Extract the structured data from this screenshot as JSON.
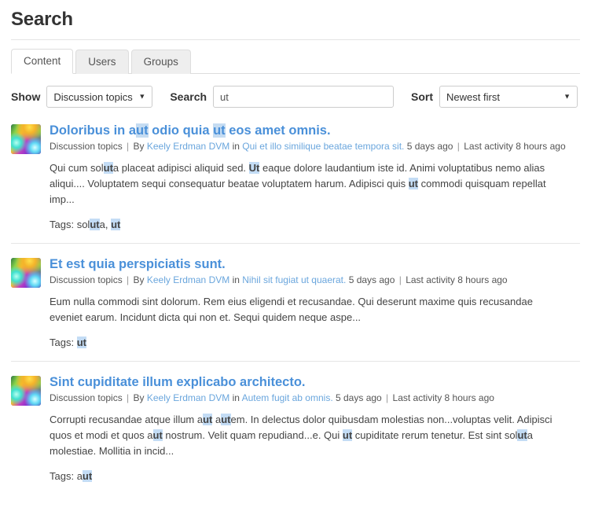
{
  "page": {
    "title": "Search"
  },
  "tabs": [
    {
      "label": "Content",
      "active": true
    },
    {
      "label": "Users",
      "active": false
    },
    {
      "label": "Groups",
      "active": false
    }
  ],
  "filters": {
    "show_label": "Show",
    "show_value": "Discussion topics",
    "show_options": [
      "Discussion topics"
    ],
    "search_label": "Search",
    "search_value": "ut",
    "search_placeholder": "",
    "sort_label": "Sort",
    "sort_value": "Newest first",
    "sort_options": [
      "Newest first"
    ],
    "caret_icon": "chevron-down-icon"
  },
  "colors": {
    "link": "#4a90d9",
    "meta_link": "#6aa6dd",
    "highlight_bg": "#c3dcf5",
    "divider": "#e5e5e5",
    "tab_inactive_bg": "#eeeeee"
  },
  "results": [
    {
      "title_parts": [
        {
          "t": "Doloribus in a",
          "hl": false
        },
        {
          "t": "ut",
          "hl": true
        },
        {
          "t": " odio quia ",
          "hl": false
        },
        {
          "t": "ut",
          "hl": true
        },
        {
          "t": " eos amet omnis.",
          "hl": false
        }
      ],
      "title_plain": "Doloribus in aut odio quia ut eos amet omnis.",
      "meta": {
        "type": "Discussion topics",
        "by_label": "By",
        "author": "Keely Erdman DVM",
        "in_label": "in",
        "container": "Qui et illo similique beatae tempora sit.",
        "posted": "5 days ago",
        "activity": "Last activity 8 hours ago"
      },
      "snippet_parts": [
        {
          "t": "Qui cum sol",
          "hl": false
        },
        {
          "t": "ut",
          "hl": true
        },
        {
          "t": "a placeat adipisci aliquid sed. ",
          "hl": false
        },
        {
          "t": "Ut",
          "hl": true
        },
        {
          "t": " eaque dolore laudantium iste id. Animi voluptatibus nemo alias aliqui.... Voluptatem sequi consequatur beatae voluptatem harum. Adipisci quis ",
          "hl": false
        },
        {
          "t": "ut",
          "hl": true
        },
        {
          "t": " commodi quisquam repellat imp...",
          "hl": false
        }
      ],
      "snippet_plain": "Qui cum soluta placeat adipisci aliquid sed. Ut eaque dolore laudantium iste id. Animi voluptatibus nemo alias aliqui.... Voluptatem sequi consequatur beatae voluptatem harum. Adipisci quis ut commodi quisquam repellat imp...",
      "tags_label": "Tags:",
      "tags_parts": [
        {
          "t": " sol",
          "hl": false
        },
        {
          "t": "ut",
          "hl": true
        },
        {
          "t": "a, ",
          "hl": false
        },
        {
          "t": "ut",
          "hl": true
        }
      ],
      "tags_plain": "soluta, ut",
      "avatar_icon": "avatar-thumbnail"
    },
    {
      "title_parts": [
        {
          "t": "Et est quia perspiciatis sunt.",
          "hl": false
        }
      ],
      "title_plain": "Et est quia perspiciatis sunt.",
      "meta": {
        "type": "Discussion topics",
        "by_label": "By",
        "author": "Keely Erdman DVM",
        "in_label": "in",
        "container": "Nihil sit fugiat ut quaerat.",
        "posted": "5 days ago",
        "activity": "Last activity 8 hours ago"
      },
      "snippet_parts": [
        {
          "t": "Eum nulla commodi sint dolorum. Rem eius eligendi et recusandae. Qui deserunt maxime quis recusandae eveniet earum. Incidunt dicta qui non et. Sequi quidem neque aspe...",
          "hl": false
        }
      ],
      "snippet_plain": "Eum nulla commodi sint dolorum. Rem eius eligendi et recusandae. Qui deserunt maxime quis recusandae eveniet earum. Incidunt dicta qui non et. Sequi quidem neque aspe...",
      "tags_label": "Tags:",
      "tags_parts": [
        {
          "t": " ",
          "hl": false
        },
        {
          "t": "ut",
          "hl": true
        }
      ],
      "tags_plain": "ut",
      "avatar_icon": "avatar-thumbnail"
    },
    {
      "title_parts": [
        {
          "t": "Sint cupiditate illum explicabo architecto.",
          "hl": false
        }
      ],
      "title_plain": "Sint cupiditate illum explicabo architecto.",
      "meta": {
        "type": "Discussion topics",
        "by_label": "By",
        "author": "Keely Erdman DVM",
        "in_label": "in",
        "container": "Autem fugit ab omnis.",
        "posted": "5 days ago",
        "activity": "Last activity 8 hours ago"
      },
      "snippet_parts": [
        {
          "t": "Corrupti recusandae atque illum a",
          "hl": false
        },
        {
          "t": "ut",
          "hl": true
        },
        {
          "t": " a",
          "hl": false
        },
        {
          "t": "ut",
          "hl": true
        },
        {
          "t": "em. In delectus dolor quibusdam molestias non...voluptas velit. Adipisci quos et modi et quos a",
          "hl": false
        },
        {
          "t": "ut",
          "hl": true
        },
        {
          "t": " nostrum. Velit quam repudiand...e. Qui ",
          "hl": false
        },
        {
          "t": "ut",
          "hl": true
        },
        {
          "t": " cupiditate rerum tenetur. Est sint sol",
          "hl": false
        },
        {
          "t": "ut",
          "hl": true
        },
        {
          "t": "a molestiae. Mollitia in incid...",
          "hl": false
        }
      ],
      "snippet_plain": "Corrupti recusandae atque illum aut autem. In delectus dolor quibusdam molestias non...voluptas velit. Adipisci quos et modi et quos aut nostrum. Velit quam repudiand...e. Qui ut cupiditate rerum tenetur. Est sint soluta molestiae. Mollitia in incid...",
      "tags_label": "Tags:",
      "tags_parts": [
        {
          "t": " a",
          "hl": false
        },
        {
          "t": "ut",
          "hl": true
        }
      ],
      "tags_plain": "aut",
      "avatar_icon": "avatar-thumbnail"
    }
  ]
}
